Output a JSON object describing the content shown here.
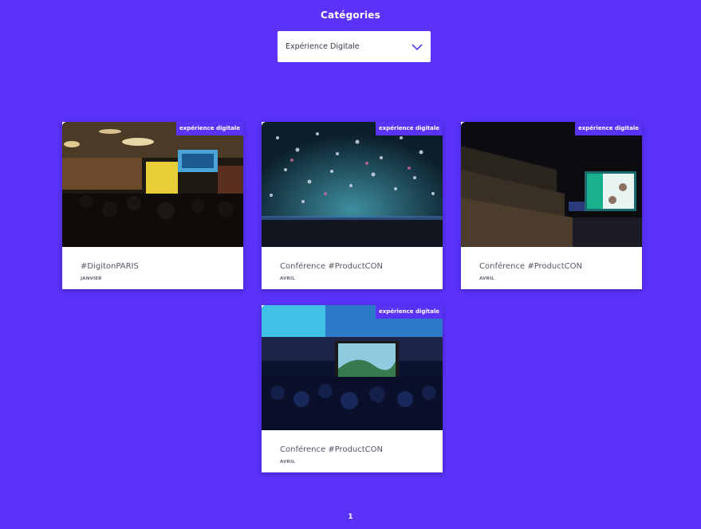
{
  "filter": {
    "title": "Catégories",
    "selected": "Expérience Digitale"
  },
  "cards": [
    {
      "tag": "expérience digitale",
      "title": "#DigitonPARIS",
      "month": "JANVIER"
    },
    {
      "tag": "expérience digitale",
      "title": "Conférence #ProductCON",
      "month": "AVRIL"
    },
    {
      "tag": "expérience digitale",
      "title": "Conférence #ProductCON",
      "month": "AVRIL"
    },
    {
      "tag": "expérience digitale",
      "title": "Conférence #ProductCON",
      "month": "AVRIL"
    }
  ],
  "pagination": {
    "current": "1"
  },
  "colors": {
    "background": "#5a32fa",
    "card": "#ffffff",
    "tag": "#5a32fa"
  }
}
